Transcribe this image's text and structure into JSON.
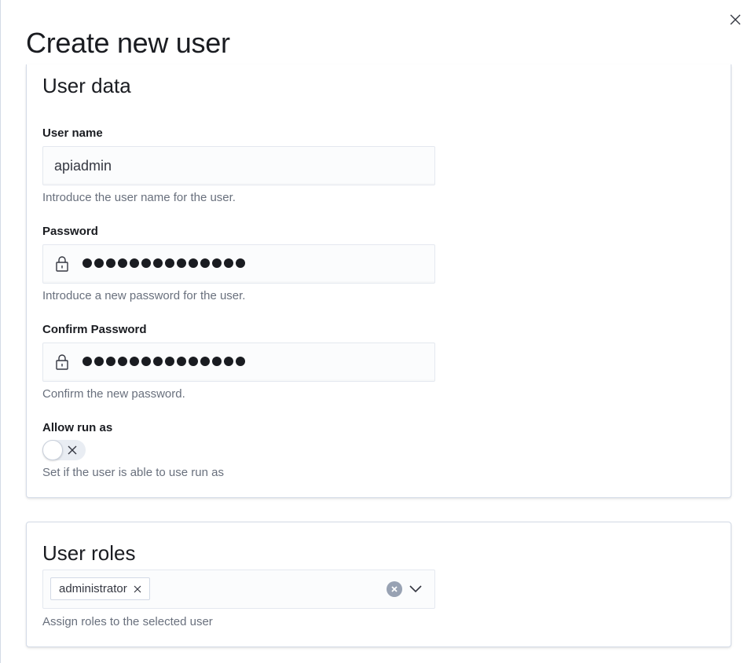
{
  "flyout": {
    "title": "Create new user"
  },
  "user_data": {
    "title": "User data",
    "username": {
      "label": "User name",
      "value": "apiadmin",
      "help": "Introduce the user name for the user."
    },
    "password": {
      "label": "Password",
      "masked_length": 14,
      "help": "Introduce a new password for the user."
    },
    "confirm_password": {
      "label": "Confirm Password",
      "masked_length": 14,
      "help": "Confirm the new password."
    },
    "run_as": {
      "label": "Allow run as",
      "enabled": false,
      "help": "Set if the user is able to use run as"
    }
  },
  "user_roles": {
    "title": "User roles",
    "selected": [
      "administrator"
    ],
    "help": "Assign roles to the selected user"
  },
  "icons": {
    "close": "close-icon",
    "lock": "lock-icon",
    "toggle_off": "cross-icon",
    "clear": "clear-circle-icon",
    "dropdown": "chevron-down-icon"
  }
}
